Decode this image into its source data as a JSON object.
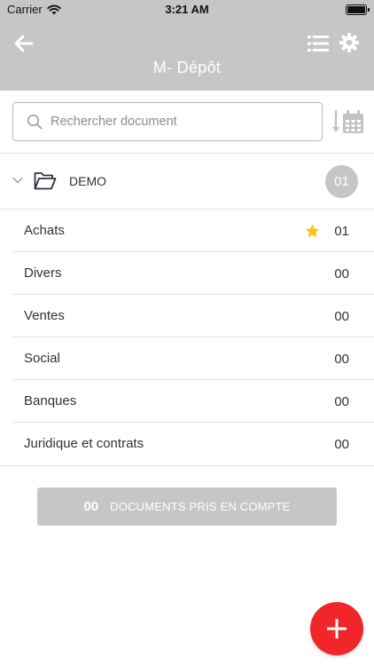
{
  "status_bar": {
    "carrier": "Carrier",
    "time": "3:21 AM"
  },
  "header": {
    "title": "M- Dépôt",
    "back_icon": "arrow-left-icon",
    "list_icon": "list-icon",
    "settings_icon": "gear-icon"
  },
  "search": {
    "placeholder": "Rechercher document",
    "value": ""
  },
  "folder": {
    "name": "DEMO",
    "count": "01",
    "expanded": true
  },
  "categories": [
    {
      "label": "Achats",
      "count": "01",
      "starred": true
    },
    {
      "label": "Divers",
      "count": "00",
      "starred": false
    },
    {
      "label": "Ventes",
      "count": "00",
      "starred": false
    },
    {
      "label": "Social",
      "count": "00",
      "starred": false
    },
    {
      "label": "Banques",
      "count": "00",
      "starred": false
    },
    {
      "label": "Juridique et contrats",
      "count": "00",
      "starred": false
    }
  ],
  "summary": {
    "count": "00",
    "label": "DOCUMENTS PRIS EN COMPTE"
  },
  "colors": {
    "header_bg": "#c6c6c6",
    "fab": "#f0262a",
    "star": "#f5c518",
    "text": "#333333"
  }
}
